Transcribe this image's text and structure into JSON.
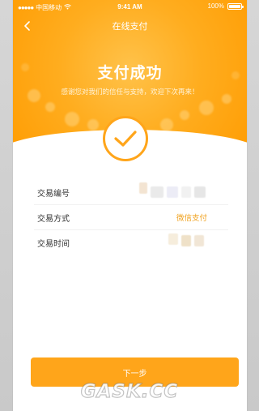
{
  "status_bar": {
    "carrier": "中国移动",
    "time": "9:41 AM",
    "battery": "100%"
  },
  "nav": {
    "title": "在线支付",
    "back_icon": "chevron-left-icon"
  },
  "result": {
    "title": "支付成功",
    "subtitle": "感谢您对我们的信任与支持，欢迎下次再来！",
    "icon": "check-icon"
  },
  "details": [
    {
      "label": "交易编号",
      "value": ""
    },
    {
      "label": "交易方式",
      "value": "微信支付"
    },
    {
      "label": "交易时间",
      "value": ""
    }
  ],
  "actions": {
    "next_label": "下一步"
  },
  "watermark": "GASK.CC",
  "colors": {
    "accent": "#ffa51a",
    "header": "#ff9b00",
    "value_text": "#f0a21f"
  }
}
